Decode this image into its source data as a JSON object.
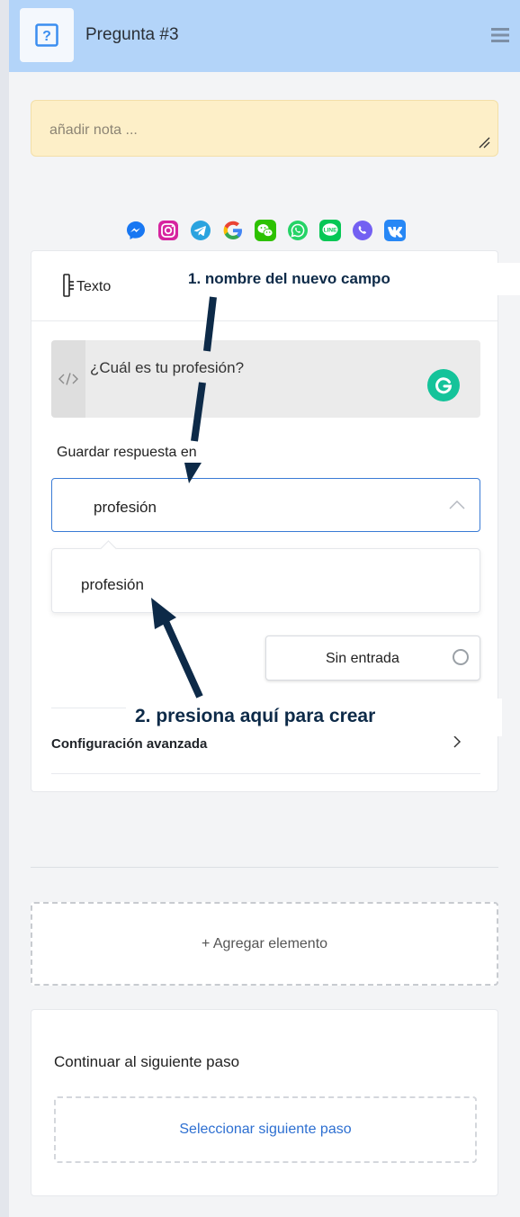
{
  "header": {
    "title": "Pregunta #3",
    "icon": "question-icon",
    "background": "#b3d4f9"
  },
  "note": {
    "placeholder": "añadir nota ..."
  },
  "channels": [
    {
      "name": "messenger-icon",
      "color": "#1877f2"
    },
    {
      "name": "instagram-icon",
      "color": "#d6249f"
    },
    {
      "name": "telegram-icon",
      "color": "#2aa3df"
    },
    {
      "name": "google-icon",
      "color": "#4285f4"
    },
    {
      "name": "wechat-icon",
      "color": "#2dc100"
    },
    {
      "name": "whatsapp-icon",
      "color": "#25d366"
    },
    {
      "name": "line-icon",
      "color": "#06c755"
    },
    {
      "name": "viber-icon",
      "color": "#7360f2"
    },
    {
      "name": "vk-icon",
      "color": "#2787f5"
    }
  ],
  "element": {
    "type_label": "Texto",
    "question": "¿Cuál es tu profesión?",
    "save_label": "Guardar respuesta en",
    "selected_field": "profesión",
    "dropdown_options": [
      "profesión"
    ],
    "no_input_label": "Sin entrada",
    "advanced_label": "Configuración avanzada"
  },
  "annotations": {
    "step1": "1. nombre del nuevo campo",
    "step2": "2. presiona aquí para crear"
  },
  "add_element_label": "+ Agregar elemento",
  "next_step": {
    "title": "Continuar al siguiente paso",
    "select_label": "Seleccionar siguiente paso"
  }
}
